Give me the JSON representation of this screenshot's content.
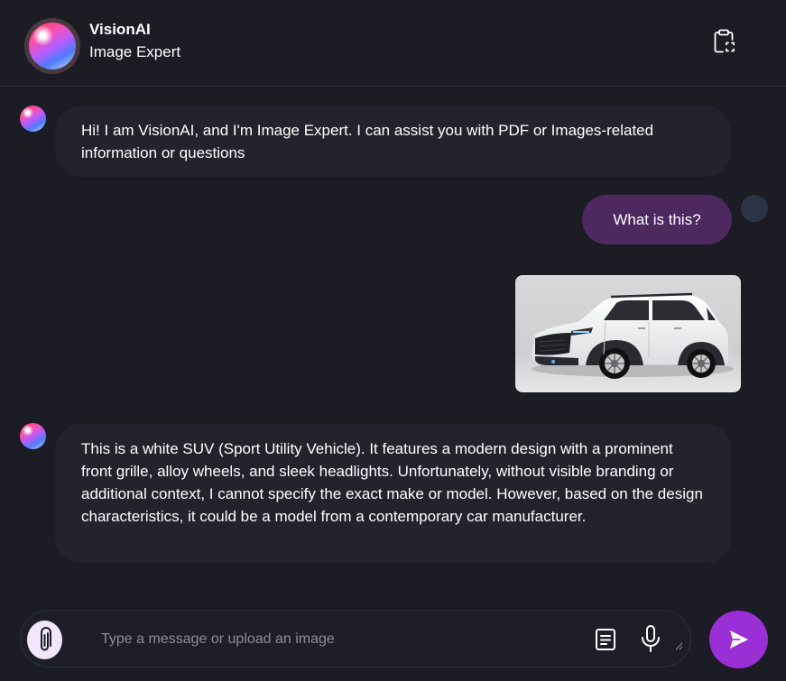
{
  "header": {
    "title": "VisionAI",
    "subtitle": "Image Expert",
    "icons": [
      "assistant-orb-icon",
      "clipboard-icon"
    ]
  },
  "messages": [
    {
      "role": "bot",
      "text": "Hi! I am VisionAI, and I'm Image Expert. I can assist you with PDF or Images-related information or questions"
    },
    {
      "role": "user",
      "text": "What is this?"
    },
    {
      "role": "user-image",
      "subject": "white SUV"
    },
    {
      "role": "bot",
      "text": "This is a white SUV (Sport Utility Vehicle). It features a modern design with a prominent front grille, alloy wheels, and sleek headlights. Unfortunately, without visible branding or additional context, I cannot specify the exact make or model. However, based on the design characteristics, it could be a model from a contemporary car manufacturer."
    }
  ],
  "composer": {
    "placeholder": "Type a message or upload an image",
    "value": "",
    "icons": [
      "paperclip-icon",
      "document-icon",
      "microphone-icon",
      "send-icon"
    ]
  },
  "colors": {
    "background": "#1b1c24",
    "bot_bubble": "#22232d",
    "user_bubble": "#4d2960",
    "send_button": "#9b2fd6",
    "attach_button": "#f1e6fb"
  }
}
